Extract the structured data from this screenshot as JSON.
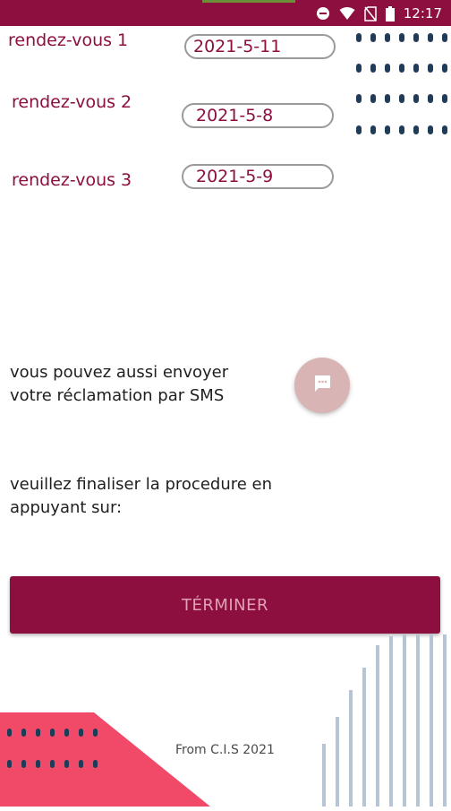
{
  "status_bar": {
    "time": "12:17",
    "icons": [
      "minus-circle-icon",
      "wifi-icon",
      "no-sim-icon",
      "battery-icon"
    ],
    "background": "#8c0f3f"
  },
  "appointments": [
    {
      "label": "rendez-vous 1",
      "date": "2021-5-11"
    },
    {
      "label": "rendez-vous 2",
      "date": "2021-5-8"
    },
    {
      "label": "rendez-vous 3",
      "date": "2021-5-9"
    }
  ],
  "sms": {
    "line1": "vous pouvez aussi envoyer",
    "line2": "votre réclamation par SMS",
    "fab_icon": "message-icon"
  },
  "finalize": {
    "line1": "veuillez finaliser la procedure en",
    "line2": "appuyant sur:"
  },
  "finish_button": {
    "label": "TÉRMINER"
  },
  "footer": {
    "text": "From C.I.S 2021"
  },
  "colors": {
    "brand": "#8c0f3f",
    "accent_pink": "#f04a68",
    "dot_navy": "#1f3b5a",
    "bar_blue": "#b7c4d6",
    "fab": "#d8b4b4"
  }
}
